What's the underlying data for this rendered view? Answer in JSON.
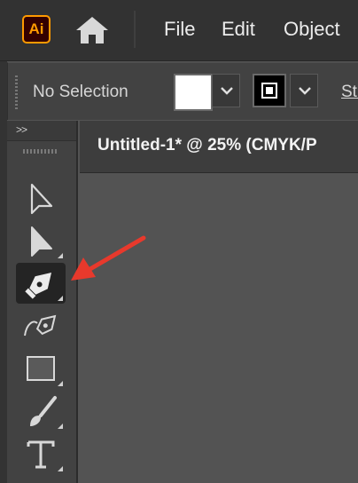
{
  "app": {
    "logo_text": "Ai",
    "accent_color": "#ff9a00",
    "menu": [
      "File",
      "Edit",
      "Object"
    ]
  },
  "control_bar": {
    "selection_status": "No Selection",
    "fill_color": "#ffffff",
    "stroke_color": "#000000",
    "stroke_label": "Str"
  },
  "toolbar": {
    "collapse_label": ">>",
    "tools": [
      {
        "name": "selection-tool",
        "icon": "selection-arrow-icon"
      },
      {
        "name": "direct-selection-tool",
        "icon": "direct-selection-icon"
      },
      {
        "name": "pen-tool",
        "icon": "pen-icon",
        "active": true
      },
      {
        "name": "curvature-tool",
        "icon": "curvature-pen-icon"
      },
      {
        "name": "rectangle-tool",
        "icon": "rectangle-icon"
      },
      {
        "name": "paintbrush-tool",
        "icon": "paintbrush-icon"
      },
      {
        "name": "type-tool",
        "icon": "type-icon"
      }
    ]
  },
  "document": {
    "tab_title": "Untitled-1* @ 25% (CMYK/P"
  },
  "annotation": {
    "arrow_color": "#e8392c",
    "points_to": "pen-tool"
  }
}
